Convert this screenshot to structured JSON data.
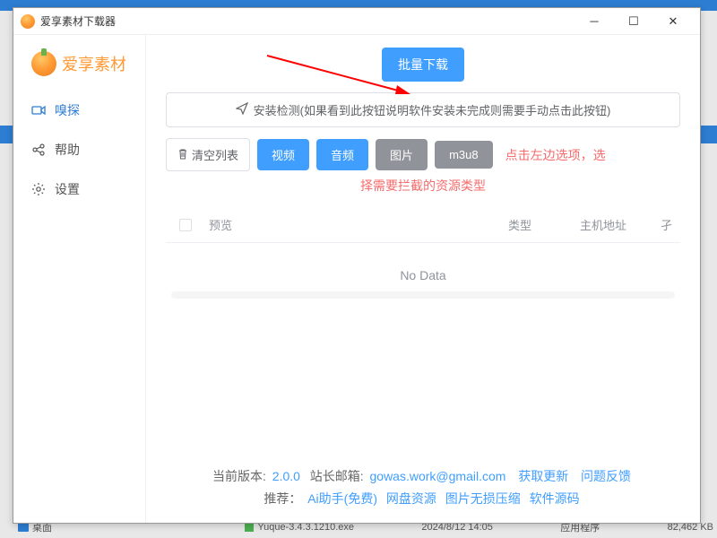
{
  "window": {
    "title": "爱享素材下载器"
  },
  "brand": {
    "name": "爱享素材"
  },
  "sidebar": {
    "items": [
      {
        "label": "嗅探"
      },
      {
        "label": "帮助"
      },
      {
        "label": "设置"
      }
    ]
  },
  "main": {
    "batch_download_label": "批量下载",
    "install_check_label": "安装检测(如果看到此按钮说明软件安装未完成则需要手动点击此按钮)",
    "clear_list_label": "清空列表",
    "chips": {
      "video": "视频",
      "audio": "音频",
      "image": "图片",
      "m3u8": "m3u8"
    },
    "hint_line1": "点击左边选项，选",
    "hint_line2": "择需要拦截的资源类型"
  },
  "table": {
    "columns": {
      "preview": "预览",
      "type": "类型",
      "host": "主机地址",
      "extra": "孑"
    },
    "no_data": "No Data"
  },
  "footer": {
    "version_prefix": "当前版本:",
    "version": "2.0.0",
    "webmaster_prefix": "站长邮箱:",
    "webmaster_email": "gowas.work@gmail.com",
    "get_update": "获取更新",
    "feedback": "问题反馈",
    "recommend_prefix": "推荐：",
    "rec_ai": "Ai助手(免费)",
    "rec_disk": "网盘资源",
    "rec_img": "图片无损压缩",
    "rec_src": "软件源码"
  },
  "behind": {
    "left1": "桌面",
    "exe": "Yuque-3.4.3.1210.exe",
    "date": "2024/8/12 14:05",
    "kind": "应用程序",
    "size": "82,462 KB"
  }
}
